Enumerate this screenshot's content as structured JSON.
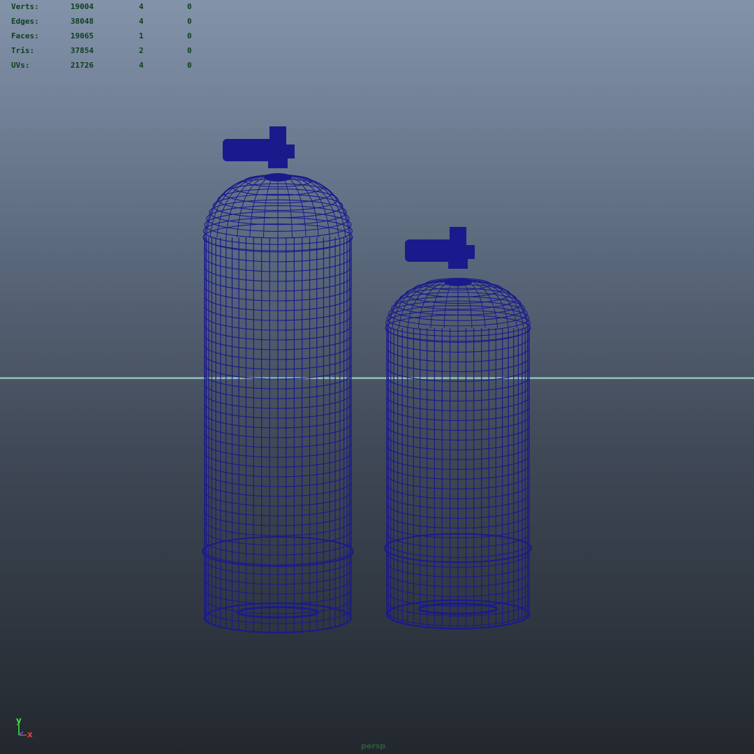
{
  "viewport": {
    "camera_label": "persp",
    "background_top": "#8393aa",
    "background_bottom": "#23282e",
    "grid_color": "#aab0b8",
    "horizon_color": "#5fd6b0",
    "wireframe_color": "#1a1a8c"
  },
  "hud": {
    "rows": [
      {
        "label": "Verts:",
        "total": "19004",
        "selected": "4",
        "highlighted": "0"
      },
      {
        "label": "Edges:",
        "total": "38048",
        "selected": "4",
        "highlighted": "0"
      },
      {
        "label": "Faces:",
        "total": "19065",
        "selected": "1",
        "highlighted": "0"
      },
      {
        "label": "Tris:",
        "total": "37854",
        "selected": "2",
        "highlighted": "0"
      },
      {
        "label": "UVs:",
        "total": "21726",
        "selected": "4",
        "highlighted": "0"
      }
    ]
  },
  "axis_gizmo": {
    "y_label": "y",
    "x_label": "x",
    "y_color": "#3fe03f",
    "x_color": "#e04040",
    "z_color": "#3a6aff"
  },
  "objects": [
    {
      "name": "scuba-tank-large"
    },
    {
      "name": "scuba-tank-small"
    }
  ]
}
